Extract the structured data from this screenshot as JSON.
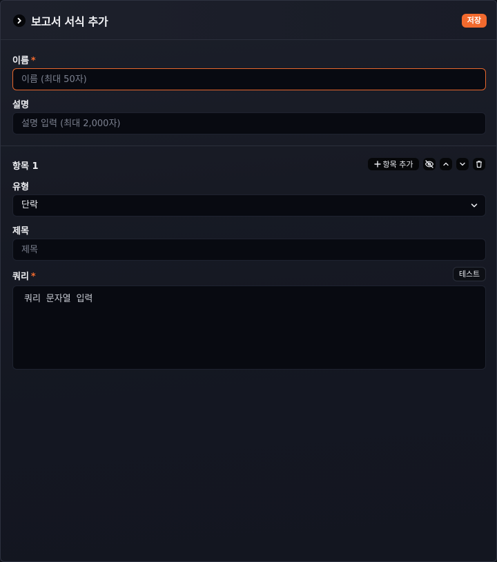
{
  "header": {
    "title": "보고서 서식 추가",
    "save_label": "저장"
  },
  "name_field": {
    "label": "이름",
    "required_mark": "*",
    "placeholder": "이름 (최대 50자)",
    "value": ""
  },
  "description_field": {
    "label": "설명",
    "placeholder": "설명 입력 (최대 2,000자)",
    "value": ""
  },
  "item": {
    "title": "항목 1",
    "add_item_label": "항목 추가",
    "type_label": "유형",
    "type_selected": "단락",
    "heading_label": "제목",
    "heading_placeholder": "제목",
    "query_label": "쿼리",
    "query_required_mark": "*",
    "test_label": "테스트",
    "query_placeholder": "쿼리 문자열 입력"
  },
  "colors": {
    "accent": "#f26a2e",
    "background": "#171a24",
    "input_background": "#080a11"
  },
  "icons": {
    "collapse": "chevron-right-icon",
    "add": "plus-icon",
    "hide": "eye-off-icon",
    "move_up": "chevron-up-icon",
    "move_down": "chevron-down-icon",
    "delete": "trash-icon",
    "select": "chevron-down-icon"
  }
}
